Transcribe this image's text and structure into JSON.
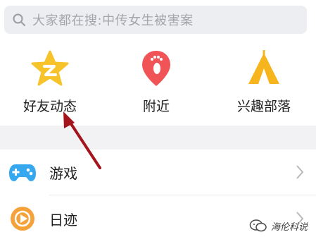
{
  "search": {
    "placeholder": "大家都在搜:中传女生被害案",
    "icon": "search-icon"
  },
  "shortcuts": [
    {
      "label": "好友动态",
      "icon": "qzone-star-icon",
      "color": "#f6c32b"
    },
    {
      "label": "附近",
      "icon": "location-footprint-icon",
      "color": "#f05457"
    },
    {
      "label": "兴趣部落",
      "icon": "tent-icon",
      "color": "#f6b51c"
    }
  ],
  "list": [
    {
      "label": "游戏",
      "icon": "gamepad-icon",
      "color": "#35a8f0"
    },
    {
      "label": "日迹",
      "icon": "play-circle-icon",
      "color": "#f6a23a"
    }
  ],
  "annotation": {
    "arrow_color": "#a3141c"
  },
  "watermark": {
    "text": "海伦科说"
  }
}
